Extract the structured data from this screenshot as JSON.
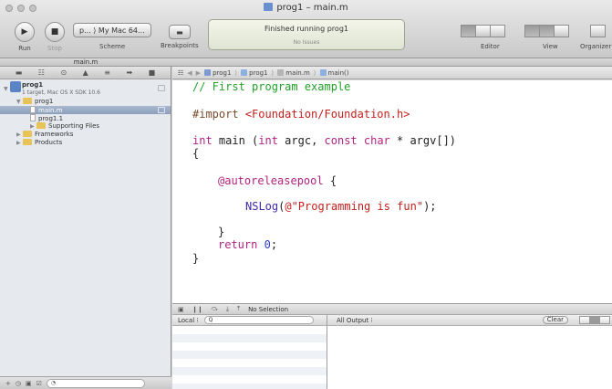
{
  "window": {
    "title": "prog1 – main.m"
  },
  "toolbar": {
    "run_label": "Run",
    "stop_label": "Stop",
    "scheme_value": "p... ⟩ My Mac 64...",
    "scheme_label": "Scheme",
    "breakpoints_label": "Breakpoints",
    "status_main": "Finished running prog1",
    "status_sub": "No Issues",
    "editor_label": "Editor",
    "view_label": "View",
    "organizer_label": "Organizer"
  },
  "tab": {
    "name": "main.m"
  },
  "navigator": {
    "project_name": "prog1",
    "project_sub": "1 target, Mac OS X SDK 10.6",
    "items": [
      {
        "label": "prog1"
      },
      {
        "label": "main.m"
      },
      {
        "label": "prog1.1"
      },
      {
        "label": "Supporting Files"
      },
      {
        "label": "Frameworks"
      },
      {
        "label": "Products"
      }
    ]
  },
  "jumpbar": {
    "crumbs": [
      "prog1",
      "prog1",
      "main.m",
      "main()"
    ]
  },
  "code": {
    "comment": "// First program example",
    "import_kw": "#import",
    "import_path": "<Foundation/Foundation.h>",
    "main_kw1": "int",
    "main_text1": " main (",
    "main_kw2": "int",
    "main_text2": " argc, ",
    "main_kw3": "const char",
    "main_text3": " * argv[])",
    "brace_open": "{",
    "autorelease_kw": "@autoreleasepool",
    "autorelease_brace": " {",
    "nslog_fn": "NSLog",
    "nslog_paren": "(",
    "nslog_str": "@\"Programming is fun\"",
    "nslog_end": ");",
    "inner_close": "}",
    "return_kw": "return",
    "return_val": "0",
    "return_end": ";",
    "brace_close": "}"
  },
  "debug": {
    "no_selection": "No Selection",
    "local_label": "Local ⁝",
    "search_icon_glyph": "Q",
    "output_label": "All Output ⁝",
    "clear_label": "Clear"
  },
  "colors": {
    "comment": "#23a029",
    "keyword": "#b0237f",
    "string": "#c51f1a",
    "number": "#2f3dc4",
    "selection": "#8d9fbb"
  }
}
